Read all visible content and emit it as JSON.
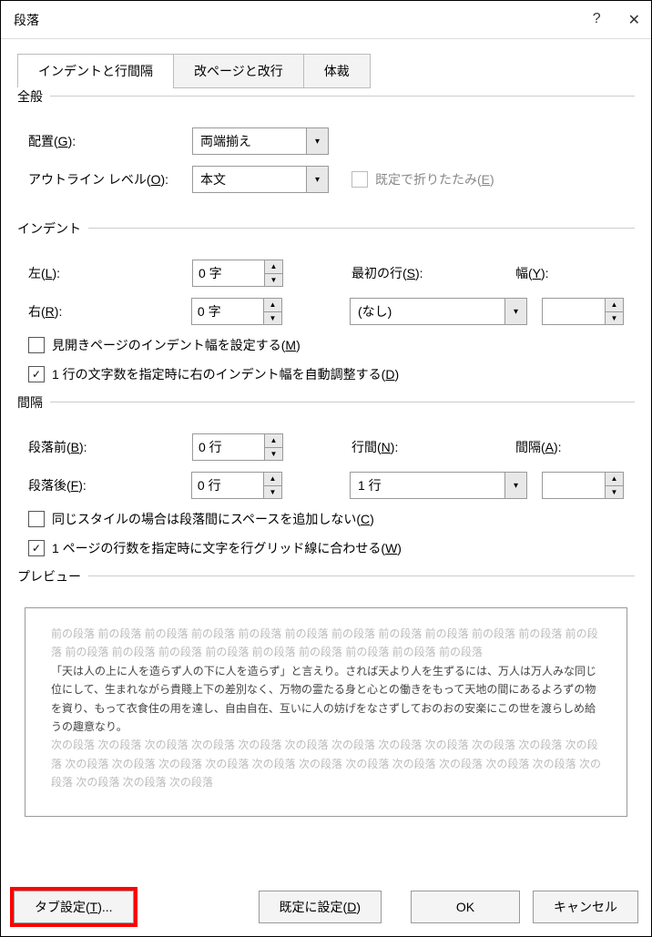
{
  "title": "段落",
  "tabs": {
    "t1": "インデントと行間隔",
    "t2": "改ページと改行",
    "t3": "体裁"
  },
  "general": {
    "legend": "全般",
    "align_label": "配置(G):",
    "align_value": "両端揃え",
    "outline_label": "アウトライン レベル(O):",
    "outline_value": "本文",
    "collapse_label": "既定で折りたたみ(E)"
  },
  "indent": {
    "legend": "インデント",
    "left_label": "左(L):",
    "left_value": "0 字",
    "right_label": "右(R):",
    "right_value": "0 字",
    "first_label": "最初の行(S):",
    "first_value": "(なし)",
    "width_label": "幅(Y):",
    "width_value": "",
    "mirror_label": "見開きページのインデント幅を設定する(M)",
    "auto_label": "1 行の文字数を指定時に右のインデント幅を自動調整する(D)"
  },
  "spacing": {
    "legend": "間隔",
    "before_label": "段落前(B):",
    "before_value": "0 行",
    "after_label": "段落後(F):",
    "after_value": "0 行",
    "linesp_label": "行間(N):",
    "linesp_value": "1 行",
    "at_label": "間隔(A):",
    "at_value": "",
    "nospace_label": "同じスタイルの場合は段落間にスペースを追加しない(C)",
    "grid_label": "1 ページの行数を指定時に文字を行グリッド線に合わせる(W)"
  },
  "preview": {
    "legend": "プレビュー",
    "before_text": "前の段落 前の段落 前の段落 前の段落 前の段落 前の段落 前の段落 前の段落 前の段落 前の段落 前の段落 前の段落 前の段落 前の段落 前の段落 前の段落 前の段落 前の段落 前の段落 前の段落 前の段落",
    "body_text": "「天は人の上に人を造らず人の下に人を造らず」と言えり。されば天より人を生ずるには、万人は万人みな同じ位にして、生まれながら貴賤上下の差別なく、万物の霊たる身と心との働きをもって天地の間にあるよろずの物を資り、もって衣食住の用を達し、自由自在、互いに人の妨げをなさずしておのおの安楽にこの世を渡らしめ給うの趣意なり。",
    "after_text": "次の段落 次の段落 次の段落 次の段落 次の段落 次の段落 次の段落 次の段落 次の段落 次の段落 次の段落 次の段落 次の段落 次の段落 次の段落 次の段落 次の段落 次の段落 次の段落 次の段落 次の段落 次の段落 次の段落 次の段落 次の段落 次の段落 次の段落"
  },
  "buttons": {
    "tabs": "タブ設定(T)...",
    "default": "既定に設定(D)",
    "ok": "OK",
    "cancel": "キャンセル"
  }
}
